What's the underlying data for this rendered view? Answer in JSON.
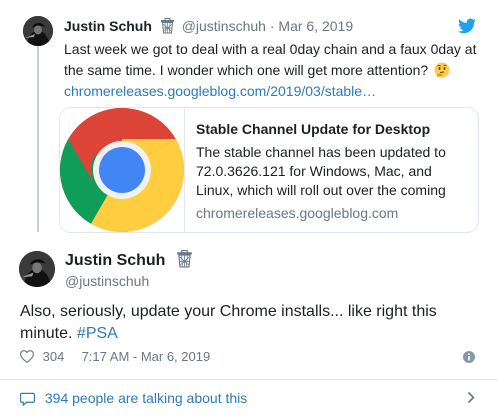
{
  "quoted_tweet": {
    "author_name": "Justin Schuh",
    "author_handle": "@justinschuh",
    "separator": "·",
    "date": "Mar 6, 2019",
    "text": "Last week we got to deal with a real 0day chain and a faux 0day at the same time. I wonder which one will get more attention?",
    "emoji_icon": "thinking-face-emoji",
    "link_text": "chromereleases.googleblog.com/2019/03/stable…",
    "link_card": {
      "title": "Stable Channel Update for Desktop",
      "description": "The stable channel has been updated to 72.0.3626.121 for Windows, Mac, and Linux,   which will roll out over the coming",
      "domain": "chromereleases.googleblog.com",
      "image_icon": "chrome-logo-icon"
    }
  },
  "main_tweet": {
    "author_name": "Justin Schuh",
    "author_handle": "@justinschuh",
    "text": "Also, seriously, update your Chrome installs... like right this minute.",
    "hashtag": "#PSA",
    "like_count": "304",
    "timestamp": "7:17 AM - Mar 6, 2019"
  },
  "footer": {
    "talking_text": "394 people are talking about this"
  },
  "colors": {
    "link": "#2b7bb9",
    "muted": "#697882",
    "twitter_blue": "#1da1f2",
    "border": "#e1e8ed"
  }
}
